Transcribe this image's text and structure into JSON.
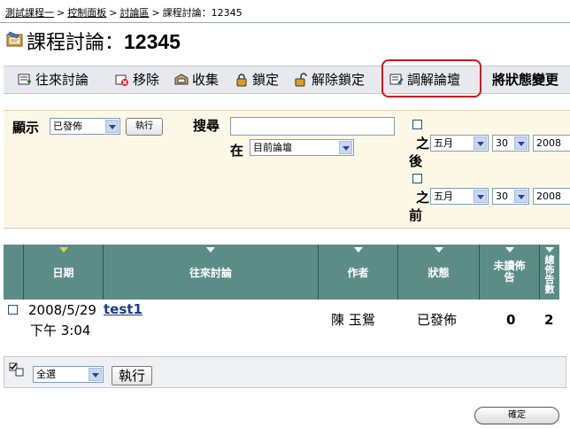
{
  "breadcrumb": {
    "items": [
      "測試課程一",
      "控制面板",
      "討論區"
    ],
    "separator": ">",
    "current": "課程討論：12345"
  },
  "title": {
    "prefix": "課程討論：",
    "name": "12345"
  },
  "toolbar": {
    "items": [
      {
        "label": "往來討論",
        "icon": "new-thread-icon"
      },
      {
        "label": "移除",
        "icon": "remove-icon"
      },
      {
        "label": "收集",
        "icon": "collect-icon"
      },
      {
        "label": "鎖定",
        "icon": "lock-icon"
      },
      {
        "label": "解除鎖定",
        "icon": "unlock-icon"
      },
      {
        "label": "調解論壇",
        "icon": "moderate-icon"
      }
    ],
    "change_status_label": "將狀態變更"
  },
  "filter": {
    "display_label": "顯示",
    "display_value": "已發佈",
    "run_label": "執行",
    "search_label": "搜尋",
    "search_value": "",
    "in_label": "在",
    "in_value": "目前論壇",
    "after_label_1": "之",
    "after_label_2": "後",
    "before_label_1": "之",
    "before_label_2": "前",
    "after_month": "五月",
    "after_day": "30",
    "after_year": "2008",
    "before_month": "五月",
    "before_day": "30",
    "before_year": "2008"
  },
  "table": {
    "headers": [
      "日期",
      "往來討論",
      "作者",
      "狀態",
      "未讀佈告",
      "總佈告數"
    ],
    "rows": [
      {
        "date": "2008/5/29",
        "time": "下午 3:04",
        "thread": "test1",
        "author": "陳 玉鴛",
        "status": "已發佈",
        "unread": "0",
        "total": "2"
      }
    ]
  },
  "footer": {
    "select_value": "全選",
    "run_label": "執行",
    "ok_label": "確定"
  },
  "colors": {
    "header_bg": "#5b8d86",
    "filter_bg": "#fdf8e6",
    "toolbar_bg": "#e7e9ee",
    "highlight": "#d0181c"
  }
}
